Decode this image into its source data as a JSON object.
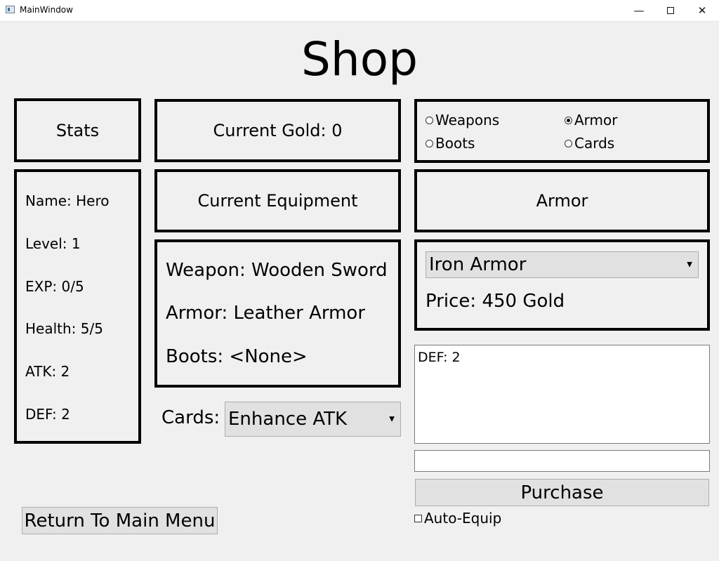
{
  "window": {
    "title": "MainWindow",
    "minimize_icon": "minimize-icon",
    "maximize_icon": "maximize-icon",
    "close_icon": "close-icon"
  },
  "page": {
    "title": "Shop"
  },
  "stats": {
    "header": "Stats",
    "name": "Name: Hero",
    "level": "Level: 1",
    "exp": "EXP: 0/5",
    "health": "Health: 5/5",
    "atk": "ATK: 2",
    "def": "DEF: 2"
  },
  "gold": {
    "label": "Current Gold: 0"
  },
  "equipment": {
    "header": "Current Equipment",
    "weapon": "Weapon: Wooden Sword",
    "armor": "Armor: Leather Armor",
    "boots": "Boots: <None>"
  },
  "cards": {
    "label": "Cards:",
    "selected": "Enhance ATK"
  },
  "category": {
    "options": [
      "Weapons",
      "Armor",
      "Boots",
      "Cards"
    ],
    "selected": "Armor"
  },
  "shop": {
    "section_title": "Armor",
    "item_selected": "Iron Armor",
    "price": "Price: 450 Gold",
    "details": "DEF: 2",
    "input_value": "",
    "purchase_label": "Purchase",
    "auto_equip_label": "Auto-Equip",
    "auto_equip_checked": false
  },
  "nav": {
    "return_label": "Return To Main Menu"
  }
}
